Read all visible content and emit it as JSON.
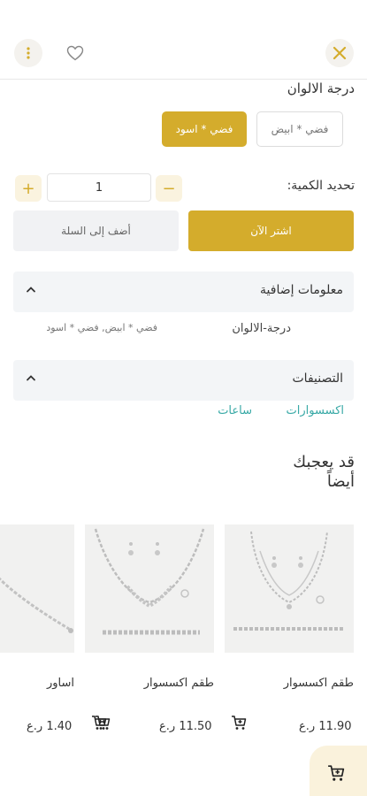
{
  "colors": {
    "accent": "#d4ac2c",
    "accent_light": "#faf2dc",
    "teal": "#38a9a6",
    "panel": "#f3f5f7"
  },
  "header": {
    "close_icon": "close-x-icon",
    "favorite_icon": "heart-outline-icon",
    "menu_icon": "vertical-dots-icon"
  },
  "color_options": {
    "title": "درجة الالوان",
    "options": [
      {
        "label": "فضي * ابيض",
        "selected": false
      },
      {
        "label": "فضي * اسود",
        "selected": true
      }
    ]
  },
  "quantity": {
    "label": "تحديد الكمية:",
    "value": "1",
    "minus": "−",
    "plus": "+"
  },
  "actions": {
    "buy_now": "اشتر الآن",
    "add_to_cart": "أضف إلى السلة"
  },
  "additional_info": {
    "title": "معلومات إضافية",
    "attribute_name": "درجة-الالوان",
    "attribute_value": "فضي * ابيض, فضي * اسود"
  },
  "categories": {
    "title": "التصنيفات",
    "items": [
      "اكسسوارات",
      "ساعات"
    ]
  },
  "related": {
    "title_line1": "قد يعجبك",
    "title_line2": "أيضاً",
    "products": [
      {
        "name": "طقم اكسسوار",
        "price": "11.90 ر.ع"
      },
      {
        "name": "طقم اكسسوار",
        "price": "11.50 ر.ع"
      },
      {
        "name": "اساور",
        "price": "1.40 ر.ع"
      }
    ]
  },
  "floating_cart": {
    "icon": "cart-add-icon"
  }
}
